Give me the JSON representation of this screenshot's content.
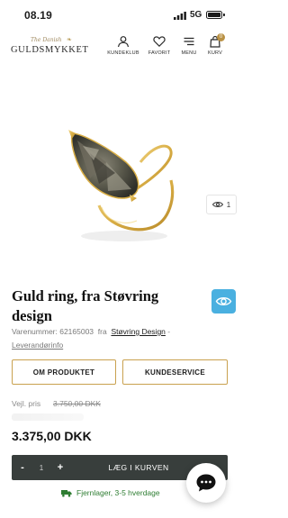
{
  "status_bar": {
    "time": "08.19",
    "network": "5G"
  },
  "header": {
    "logo_script": "The Danish",
    "logo_text": "GULDSMYKKET",
    "nav": [
      {
        "label": "KUNDEKLUB",
        "icon": "user-icon"
      },
      {
        "label": "FAVORIT",
        "icon": "heart-icon"
      },
      {
        "label": "MENU",
        "icon": "menu-icon"
      },
      {
        "label": "KURV",
        "icon": "bag-icon"
      }
    ],
    "cart_count": "0"
  },
  "image": {
    "view_count": "1"
  },
  "product": {
    "title": "Guld ring, fra Støvring design",
    "variant_label": "Varenummer: 62165003",
    "from_text": "fra",
    "brand": "Støvring Design",
    "separator": "-",
    "supplier_link": "Leverandørinfo"
  },
  "buttons": {
    "about": "OM PRODUKTET",
    "service": "KUNDESERVICE"
  },
  "pricing": {
    "label": "Vejl. pris",
    "old_price": "3.750,00 DKK",
    "price": "3.375,00 DKK"
  },
  "cart": {
    "minus": "-",
    "quantity": "1",
    "plus": "+",
    "add_label": "LÆG I KURVEN"
  },
  "stock": {
    "text": "Fjernlager, 3-5 hverdage",
    "color": "#2e7d32"
  },
  "colors": {
    "accent": "#c9a14f",
    "badge": "#b99144",
    "bar": "#383e3c",
    "eye": "#4ab0e0"
  }
}
